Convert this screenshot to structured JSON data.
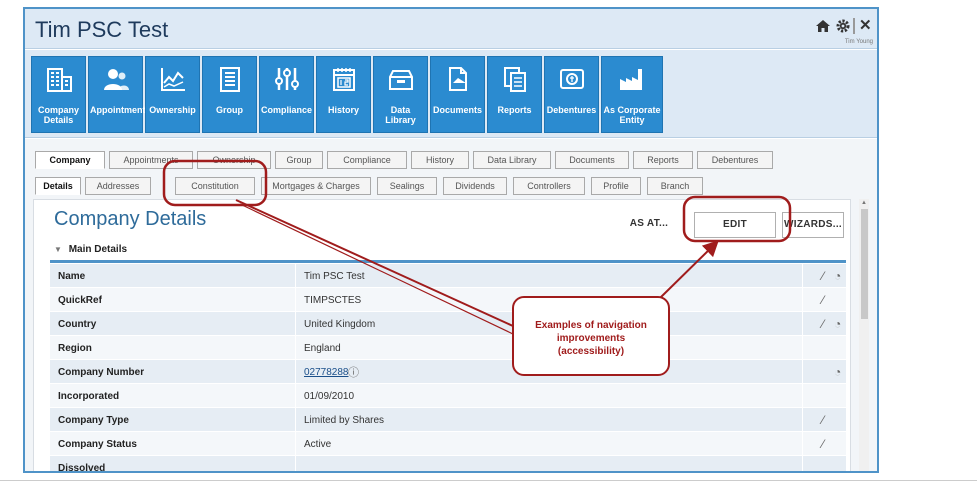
{
  "app": {
    "title": "Tim PSC Test",
    "user_name": "Tim Young"
  },
  "ribbon": [
    {
      "icon": "building-icon",
      "label": "Company Details"
    },
    {
      "icon": "people-icon",
      "label": "Appointments"
    },
    {
      "icon": "chart-icon",
      "label": "Ownership"
    },
    {
      "icon": "group-icon",
      "label": "Group"
    },
    {
      "icon": "compliance-icon",
      "label": "Compliance"
    },
    {
      "icon": "calendar-icon",
      "label": "History"
    },
    {
      "icon": "library-icon",
      "label": "Data Library"
    },
    {
      "icon": "documents-icon",
      "label": "Documents"
    },
    {
      "icon": "reports-icon",
      "label": "Reports"
    },
    {
      "icon": "debentures-icon",
      "label": "Debentures"
    },
    {
      "icon": "factory-icon",
      "label": "As Corporate Entity"
    }
  ],
  "tabs_top": [
    "Company",
    "Appointments",
    "Ownership",
    "Group",
    "Compliance",
    "History",
    "Data Library",
    "Documents",
    "Reports",
    "Debentures"
  ],
  "tabs_sub": [
    "Details",
    "Addresses",
    "Constitution",
    "Mortgages & Charges",
    "Sealings",
    "Dividends",
    "Controllers",
    "Profile",
    "Branch"
  ],
  "page": {
    "title": "Company Details",
    "as_at_label": "AS AT...",
    "edit_label": "EDIT",
    "wizards_label": "WIZARDS...",
    "section_label": "Main Details"
  },
  "rows": [
    {
      "label": "Name",
      "value": "Tim PSC Test",
      "icons": [
        "wand-icon",
        "globe-icon"
      ]
    },
    {
      "label": "QuickRef",
      "value": "TIMPSCTES",
      "icons": [
        "wand-icon"
      ]
    },
    {
      "label": "Country",
      "value": "United Kingdom",
      "icons": [
        "wand-icon",
        "globe-icon"
      ]
    },
    {
      "label": "Region",
      "value": "England",
      "icons": []
    },
    {
      "label": "Company Number",
      "value": "02778288",
      "link": true,
      "icons": [
        "globe-icon"
      ]
    },
    {
      "label": "Incorporated",
      "value": "01/09/2010",
      "icons": []
    },
    {
      "label": "Company Type",
      "value": "Limited by Shares",
      "icons": [
        "wand-icon"
      ]
    },
    {
      "label": "Company Status",
      "value": "Active",
      "icons": [
        "wand-icon"
      ]
    },
    {
      "label": "Dissolved",
      "value": "",
      "icons": []
    }
  ],
  "callout": {
    "line1": "Examples of navigation",
    "line2": "improvements",
    "line3": "(accessibility)"
  },
  "colors": {
    "accent": "#2b8bd0",
    "annotation": "#a01c1c",
    "title": "#2e6b9a"
  }
}
